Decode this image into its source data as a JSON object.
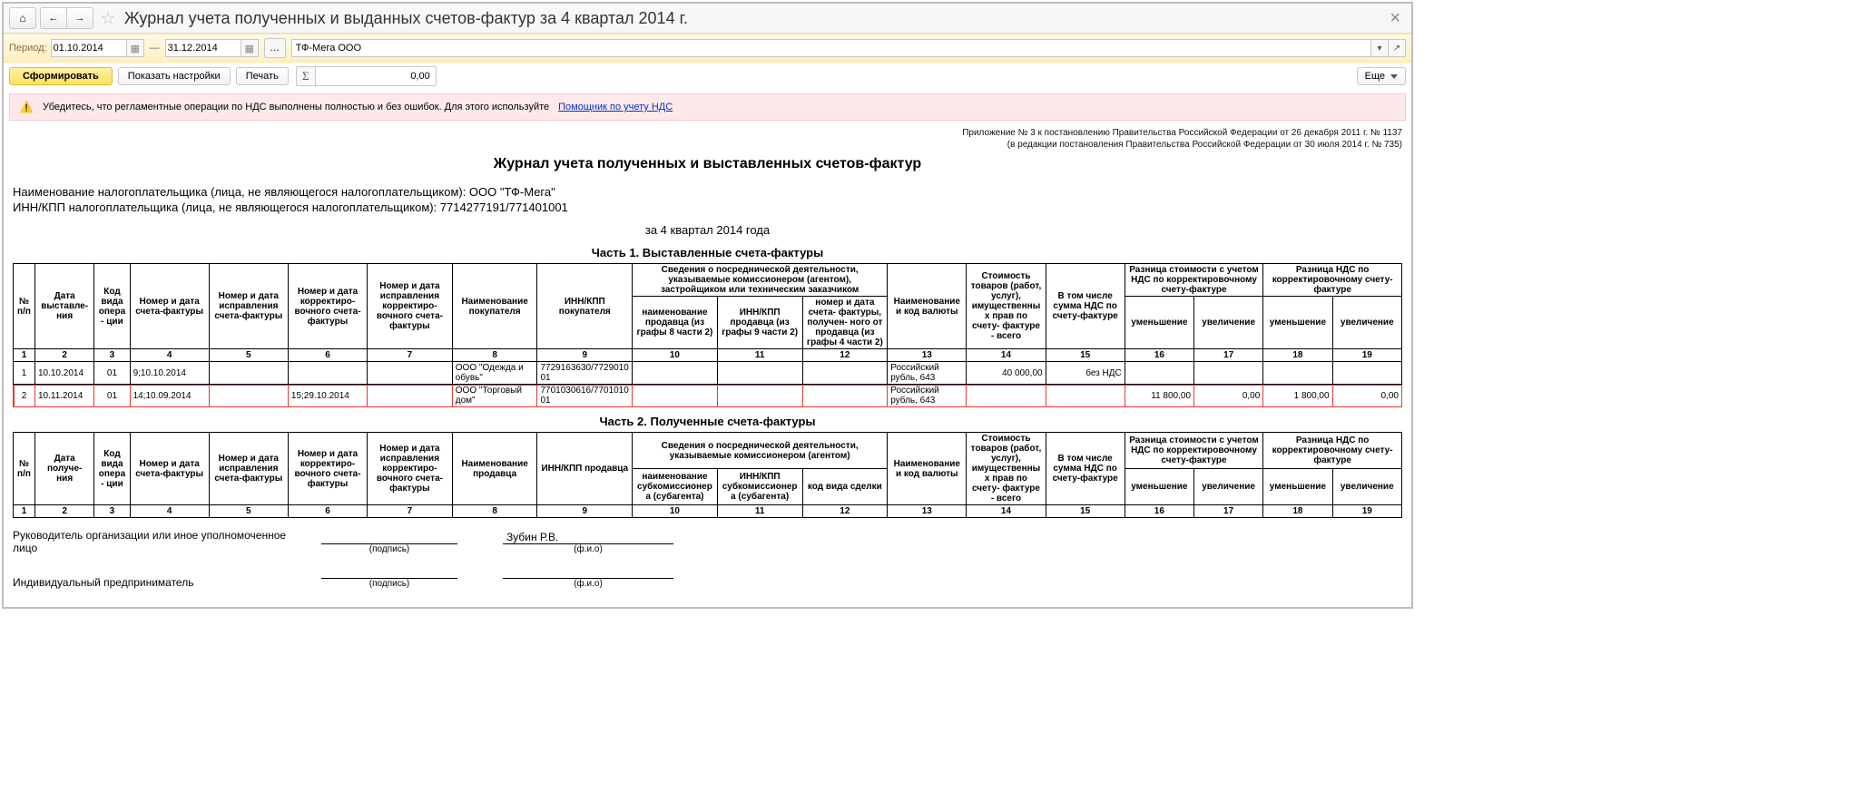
{
  "topbar": {
    "title": "Журнал учета полученных и выданных счетов-фактур за 4 квартал 2014 г."
  },
  "period": {
    "label": "Период:",
    "from": "01.10.2014",
    "to": "31.12.2014",
    "org": "ТФ-Мега ООО"
  },
  "toolbar": {
    "form": "Сформировать",
    "settings": "Показать настройки",
    "print": "Печать",
    "sum": "0,00",
    "more": "Еще"
  },
  "note": {
    "text": "Убедитесь, что регламентные операции по НДС выполнены полностью и без ошибок. Для этого используйте",
    "link": "Помощник по учету НДС"
  },
  "regtext": {
    "l1": "Приложение № 3 к постановлению Правительства Российской Федерации от 26 декабря 2011 г. № 1137",
    "l2": "(в редакции постановления Правительства Российской Федерации от 30 июля 2014 г. № 735)"
  },
  "report": {
    "main_title": "Журнал учета полученных и выставленных счетов-фактур",
    "tax_name_line": "Наименование налогоплательщика (лица, не являющегося налогоплательщиком): ООО \"ТФ-Мега\"",
    "tax_inn_line": "ИНН/КПП налогоплательщика (лица, не являющегося налогоплательщиком): 7714277191/771401001",
    "period_line": "за 4 квартал 2014 года"
  },
  "part1": {
    "title": "Часть 1. Выставленные счета-фактуры",
    "h": {
      "n": "№ п/п",
      "date": "Дата выставле-\nния",
      "code": "Код вида опера-\nции",
      "numdate": "Номер и дата счета-фактуры",
      "ispr": "Номер и дата исправления счета-фактуры",
      "korr": "Номер и дата корректиро-\nвочного счета-фактуры",
      "isprkorr": "Номер и дата исправления корректиро-\nвочного счета-\nфактуры",
      "buyer": "Наименование покупателя",
      "innkpp": "ИНН/КПП покупателя",
      "posr_top": "Сведения о посреднической деятельности, указываемые комиссионером (агентом), застройщиком или техническим заказчиком",
      "posr_a": "наименование продавца (из графы 8 части 2)",
      "posr_b": "ИНН/КПП продавца (из графы 9 части 2)",
      "posr_c": "номер и дата счета-\nфактуры, получен-\nного от продавца (из графы 4 части 2)",
      "currency": "Наименование и код валюты",
      "cost": "Стоимость товаров (работ, услуг), имущественных прав по счету-\nфактуре - всего",
      "nds": "В том числе сумма НДС по счету-фактуре",
      "diff_cost_top": "Разница стоимости с учетом НДС по корректировочному счету-фактуре",
      "diff_nds_top": "Разница НДС по корректировочному счету-фактуре",
      "dec": "уменьшение",
      "inc": "увеличение"
    },
    "nums": [
      "1",
      "2",
      "3",
      "4",
      "5",
      "6",
      "7",
      "8",
      "9",
      "10",
      "11",
      "12",
      "13",
      "14",
      "15",
      "16",
      "17",
      "18",
      "19"
    ],
    "rows": [
      {
        "n": "1",
        "date": "10.10.2014",
        "code": "01",
        "numdate": "9;10.10.2014",
        "ispr": "",
        "korr": "",
        "isprkorr": "",
        "buyer": "ООО \"Одежда и обувь\"",
        "innkpp": "7729163630/772901001",
        "pa": "",
        "pb": "",
        "pc": "",
        "currency": "Российский рубль, 643",
        "cost": "40 000,00",
        "nds": "без НДС",
        "d1": "",
        "d2": "",
        "d3": "",
        "d4": ""
      },
      {
        "n": "2",
        "date": "10.11.2014",
        "code": "01",
        "numdate": "14;10.09.2014",
        "ispr": "",
        "korr": "15;29.10.2014",
        "isprkorr": "",
        "buyer": "ООО \"Торговый дом\"",
        "innkpp": "7701030616/770101001",
        "pa": "",
        "pb": "",
        "pc": "",
        "currency": "Российский рубль, 643",
        "cost": "",
        "nds": "",
        "d1": "11 800,00",
        "d2": "0,00",
        "d3": "1 800,00",
        "d4": "0,00"
      }
    ]
  },
  "part2": {
    "title": "Часть 2. Полученные счета-фактуры",
    "h": {
      "n": "№ п/п",
      "date": "Дата получе-\nния",
      "code": "Код вида опера-\nции",
      "numdate": "Номер и дата счета-фактуры",
      "ispr": "Номер и дата исправления счета-фактуры",
      "korr": "Номер и дата корректиро-\nвочного счета-фактуры",
      "isprkorr": "Номер и дата исправления корректиро-\nвочного счета-\nфактуры",
      "seller": "Наименование продавца",
      "innkpp": "ИНН/КПП продавца",
      "posr_top": "Сведения о посреднической деятельности, указываемые комиссионером (агентом)",
      "posr_a": "наименование субкомиссионера (субагента)",
      "posr_b": "ИНН/КПП субкомиссионера (субагента)",
      "posr_c": "код вида сделки",
      "currency": "Наименование и код валюты",
      "cost": "Стоимость товаров (работ, услуг), имущественных прав по счету-\nфактуре - всего",
      "nds": "В том числе сумма НДС по счету-фактуре",
      "diff_cost_top": "Разница стоимости с учетом НДС по корректировочному счету-фактуре",
      "diff_nds_top": "Разница НДС по корректировочному счету-фактуре",
      "dec": "уменьшение",
      "inc": "увеличение"
    },
    "nums": [
      "1",
      "2",
      "3",
      "4",
      "5",
      "6",
      "7",
      "8",
      "9",
      "10",
      "11",
      "12",
      "13",
      "14",
      "15",
      "16",
      "17",
      "18",
      "19"
    ]
  },
  "sig": {
    "head_lbl": "Руководитель организации или иное уполномоченное лицо",
    "head_name": "Зубин Р.В.",
    "ip_lbl": "Индивидуальный предприниматель",
    "under_sign": "(подпись)",
    "under_fio": "(ф.и.о)"
  }
}
